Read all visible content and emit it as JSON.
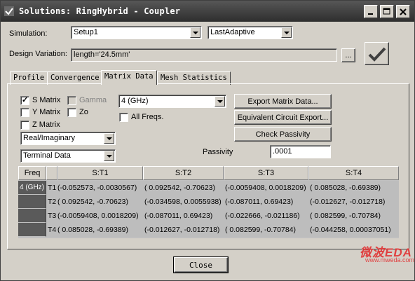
{
  "window": {
    "title": "Solutions: RingHybrid - Coupler"
  },
  "simulation": {
    "label": "Simulation:",
    "setup_value": "Setup1",
    "pass_value": "LastAdaptive"
  },
  "design_variation": {
    "label": "Design Variation:",
    "value": "length='24.5mm'",
    "browse_label": "..."
  },
  "tabs": [
    {
      "label": "Profile"
    },
    {
      "label": "Convergence"
    },
    {
      "label": "Matrix Data"
    },
    {
      "label": "Mesh Statistics"
    }
  ],
  "matrix": {
    "s_matrix": {
      "label": "S Matrix",
      "checked": true
    },
    "gamma": {
      "label": "Gamma",
      "checked": false
    },
    "y_matrix": {
      "label": "Y Matrix",
      "checked": false
    },
    "zo": {
      "label": "Zo",
      "checked": false
    },
    "z_matrix": {
      "label": "Z Matrix",
      "checked": false
    },
    "frequency_value": "4 (GHz)",
    "all_freqs": {
      "label": "All Freqs.",
      "checked": false
    },
    "format_value": "Real/Imaginary",
    "data_type_value": "Terminal Data",
    "export_matrix_label": "Export Matrix Data...",
    "equivalent_circuit_label": "Equivalent Circuit Export...",
    "check_passivity_label": "Check Passivity",
    "passivity_label": "Passivity",
    "passivity_value": ".0001"
  },
  "table": {
    "freq_header": "Freq",
    "columns": [
      "S:T1",
      "S:T2",
      "S:T3",
      "S:T4"
    ],
    "freq_value": "4 (GHz)",
    "rows": [
      {
        "port": "T1",
        "cells": [
          "(-0.052573, -0.0030567)",
          "( 0.092542, -0.70623)",
          "(-0.0059408, 0.0018209)",
          "( 0.085028, -0.69389)"
        ]
      },
      {
        "port": "T2",
        "cells": [
          "( 0.092542, -0.70623)",
          "(-0.034598, 0.0055938)",
          "(-0.087011, 0.69423)",
          "(-0.012627, -0.012718)"
        ]
      },
      {
        "port": "T3",
        "cells": [
          "(-0.0059408, 0.0018209)",
          "(-0.087011, 0.69423)",
          "(-0.022666, -0.021186)",
          "( 0.082599, -0.70784)"
        ]
      },
      {
        "port": "T4",
        "cells": [
          "( 0.085028, -0.69389)",
          "(-0.012627, -0.012718)",
          "( 0.082599, -0.70784)",
          "(-0.044258, 0.00037051)"
        ]
      }
    ]
  },
  "footer": {
    "close_label": "Close"
  },
  "watermark": {
    "line1": "微波EDA",
    "line2": "www.mweda.com"
  },
  "colors": {
    "dialog_bg": "#d4d0c8",
    "titlebar_bg": "#3a3a3a",
    "grid_header_dark": "#5a5a5a",
    "watermark": "#e04040"
  }
}
